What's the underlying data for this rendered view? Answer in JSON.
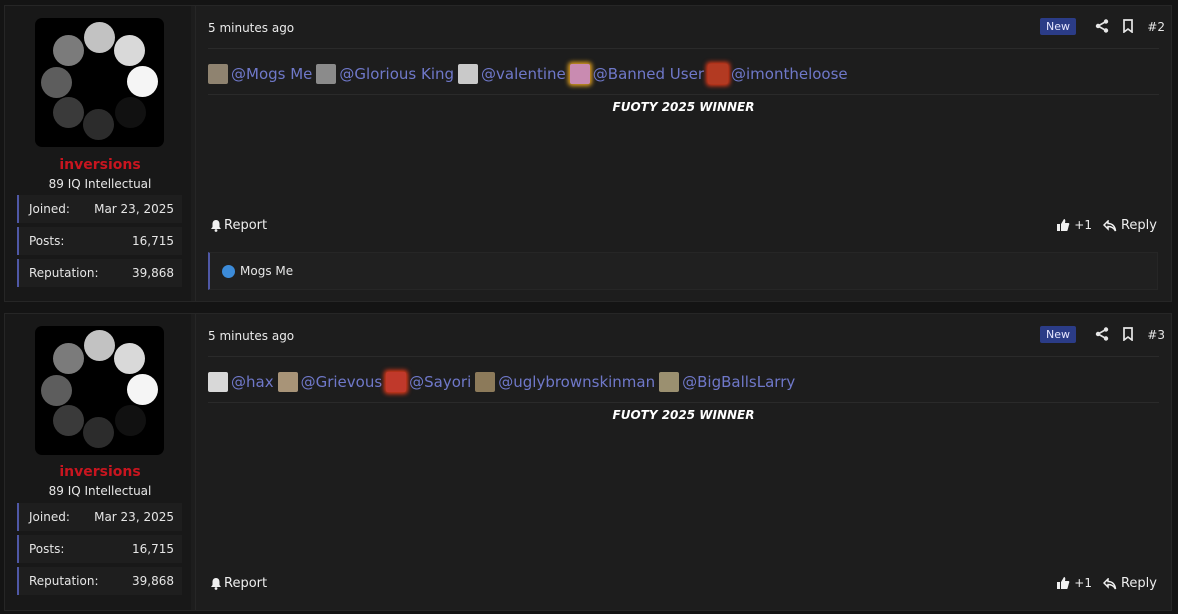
{
  "posts": [
    {
      "author": {
        "name": "inversions",
        "title": "89 IQ Intellectual",
        "stats": [
          {
            "label": "Joined:",
            "value": "Mar 23, 2025"
          },
          {
            "label": "Posts:",
            "value": "16,715"
          },
          {
            "label": "Reputation:",
            "value": "39,868"
          }
        ]
      },
      "time": "5 minutes ago",
      "badge": "New",
      "number": "#2",
      "mentions": [
        {
          "name": "@Mogs Me",
          "avatar_color": "#8f8370"
        },
        {
          "name": "@Glorious King",
          "avatar_color": "#8b8b8b"
        },
        {
          "name": "@valentine",
          "avatar_color": "#c9c9c9"
        },
        {
          "name": "@Banned User",
          "avatar_color": "#c98bb1"
        },
        {
          "name": "@imontheloose",
          "avatar_color": "#b33a22"
        }
      ],
      "signature": "FUOTY 2025 WINNER",
      "actions": {
        "report": "Report",
        "like": "+1",
        "reply": "Reply"
      },
      "reactions": {
        "users": "Mogs Me"
      }
    },
    {
      "author": {
        "name": "inversions",
        "title": "89 IQ Intellectual",
        "stats": [
          {
            "label": "Joined:",
            "value": "Mar 23, 2025"
          },
          {
            "label": "Posts:",
            "value": "16,715"
          },
          {
            "label": "Reputation:",
            "value": "39,868"
          }
        ]
      },
      "time": "5 minutes ago",
      "badge": "New",
      "number": "#3",
      "mentions": [
        {
          "name": "@hax",
          "avatar_color": "#d8d8d8"
        },
        {
          "name": "@Grievous",
          "avatar_color": "#a89478"
        },
        {
          "name": "@Sayori",
          "avatar_color": "#c0392b"
        },
        {
          "name": "@uglybrownskinman",
          "avatar_color": "#8c7a5a"
        },
        {
          "name": "@BigBallsLarry",
          "avatar_color": "#9b9070"
        }
      ],
      "signature": "FUOTY 2025 WINNER",
      "actions": {
        "report": "Report",
        "like": "+1",
        "reply": "Reply"
      }
    }
  ]
}
